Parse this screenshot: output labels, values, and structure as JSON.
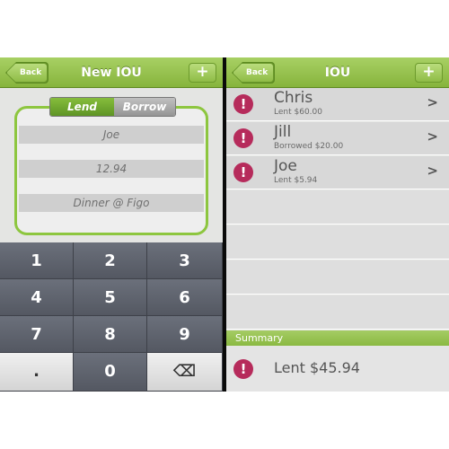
{
  "left": {
    "nav": {
      "back": "Back",
      "title": "New IOU",
      "add": "+"
    },
    "segment": {
      "lend": "Lend",
      "borrow": "Borrow"
    },
    "fields": {
      "name": "Joe",
      "amount": "12.94",
      "note": "Dinner @ Figo"
    },
    "keypad": {
      "keys": [
        "1",
        "2",
        "3",
        "4",
        "5",
        "6",
        "7",
        "8",
        "9",
        ".",
        "0",
        "⌫"
      ]
    }
  },
  "right": {
    "nav": {
      "back": "Back",
      "title": "IOU",
      "add": "+"
    },
    "items": [
      {
        "name": "Chris",
        "detail": "Lent $60.00"
      },
      {
        "name": "Jill",
        "detail": "Borrowed $20.00"
      },
      {
        "name": "Joe",
        "detail": "Lent $5.94"
      }
    ],
    "summary": {
      "header": "Summary",
      "text": "Lent $45.94"
    },
    "alert_glyph": "!",
    "chevron_glyph": ">"
  },
  "colors": {
    "accent_green": "#8dc63f",
    "alert_red": "#b62b5b",
    "keypad_gray": "#5f636e"
  }
}
